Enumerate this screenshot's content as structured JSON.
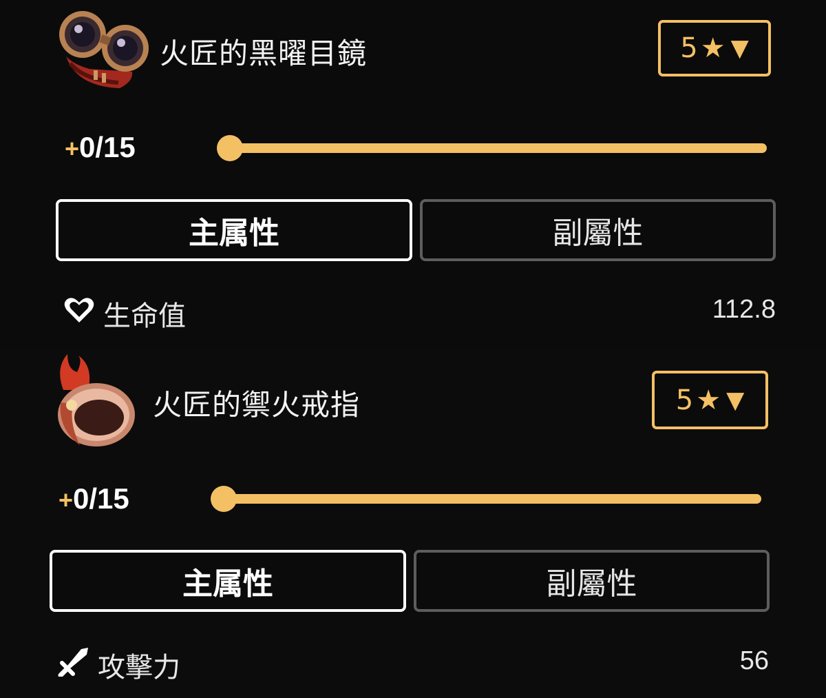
{
  "items": [
    {
      "name": "火匠的黑曜目鏡",
      "icon": "goggles-icon",
      "rarity": {
        "value": "5",
        "star": "★",
        "chevron": "▼"
      },
      "level": {
        "prefix": "+",
        "text": "0/15",
        "current": 0,
        "max": 15
      },
      "tabs": {
        "main": "主属性",
        "sub": "副屬性",
        "active": "main"
      },
      "stat": {
        "icon": "heart-icon",
        "label": "生命值",
        "value": "112.8"
      }
    },
    {
      "name": "火匠的禦火戒指",
      "icon": "flame-ring-icon",
      "rarity": {
        "value": "5",
        "star": "★",
        "chevron": "▼"
      },
      "level": {
        "prefix": "+",
        "text": "0/15",
        "current": 0,
        "max": 15
      },
      "tabs": {
        "main": "主属性",
        "sub": "副屬性",
        "active": "main"
      },
      "stat": {
        "icon": "sword-icon",
        "label": "攻擊力",
        "value": "56"
      }
    }
  ],
  "colors": {
    "accent": "#f4c064",
    "background": "#0b0b0b",
    "inactive_border": "#5d5d5d"
  }
}
